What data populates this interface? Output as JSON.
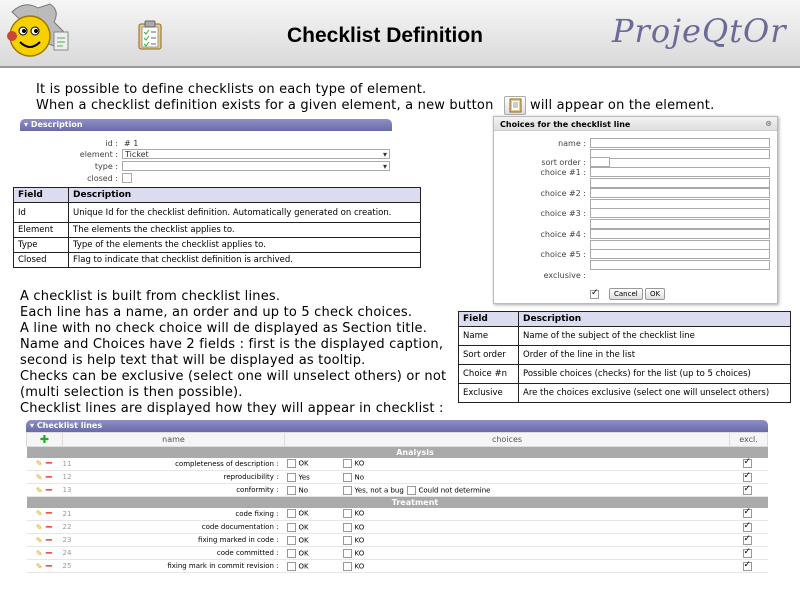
{
  "header": {
    "title": "Checklist Definition",
    "brand": "ProjeQtOr"
  },
  "intro": {
    "line1": "It is possible to define checklists on each type of element.",
    "line2a": "When a checklist definition exists for a given element, a new button",
    "line2b": "will appear on the element."
  },
  "description_form": {
    "section": "Description",
    "id_label": "id :",
    "id_value": "# 1",
    "element_label": "element :",
    "element_value": "Ticket",
    "type_label": "type :",
    "closed_label": "closed :"
  },
  "field_table": {
    "headers": [
      "Field",
      "Description"
    ],
    "rows": [
      [
        "Id",
        "Unique Id for the checklist definition. Automatically generated on creation."
      ],
      [
        "Element",
        "The elements the checklist applies to."
      ],
      [
        "Type",
        "Type of the elements the checklist applies to."
      ],
      [
        "Closed",
        "Flag to indicate that checklist definition is archived."
      ]
    ]
  },
  "dialog": {
    "title": "Choices for the checklist line",
    "name_label": "name :",
    "sort_label": "sort order :",
    "choice1": "choice #1 :",
    "choice2": "choice #2 :",
    "choice3": "choice #3 :",
    "choice4": "choice #4 :",
    "choice5": "choice #5 :",
    "exclusive_label": "exclusive :",
    "cancel": "Cancel",
    "ok": "OK"
  },
  "body_text": [
    "A checklist is built from checklist lines.",
    "Each line has a name, an order and up to 5 check choices.",
    "A line with no check choice will de displayed as Section title.",
    "Name and Choices have 2 fields : first is the displayed caption,",
    "second is help text that will be displayed as tooltip.",
    "Checks can be exclusive (select one will unselect others) or not",
    "(multi selection is then possible).",
    "Checklist lines are displayed how they will appear in checklist :"
  ],
  "choice_table": {
    "headers": [
      "Field",
      "Description"
    ],
    "rows": [
      [
        "Name",
        "Name of the subject of the checklist line"
      ],
      [
        "Sort order",
        "Order of the line in the list"
      ],
      [
        "Choice #n",
        "Possible choices (checks) for the list (up to 5 choices)"
      ],
      [
        "Exclusive",
        "Are the choices exclusive (select one will unselect others)"
      ]
    ]
  },
  "checklist": {
    "section": "Checklist lines",
    "col_name": "name",
    "col_choices": "choices",
    "col_excl": "excl.",
    "groups": [
      {
        "title": "Analysis",
        "rows": [
          {
            "num": "11",
            "name": "completeness of description :",
            "choices": [
              "OK",
              "KO"
            ]
          },
          {
            "num": "12",
            "name": "reproducibility :",
            "choices": [
              "Yes",
              "No"
            ]
          },
          {
            "num": "13",
            "name": "conformity :",
            "choices": [
              "No",
              "Yes, not a bug",
              "Could not determine"
            ]
          }
        ]
      },
      {
        "title": "Treatment",
        "rows": [
          {
            "num": "21",
            "name": "code fixing :",
            "choices": [
              "OK",
              "KO"
            ]
          },
          {
            "num": "22",
            "name": "code documentation :",
            "choices": [
              "OK",
              "KO"
            ]
          },
          {
            "num": "23",
            "name": "fixing marked in code :",
            "choices": [
              "OK",
              "KO"
            ]
          },
          {
            "num": "24",
            "name": "code committed :",
            "choices": [
              "OK",
              "KO"
            ]
          },
          {
            "num": "25",
            "name": "fixing mark in commit revision :",
            "choices": [
              "OK",
              "KO"
            ]
          }
        ]
      }
    ]
  }
}
